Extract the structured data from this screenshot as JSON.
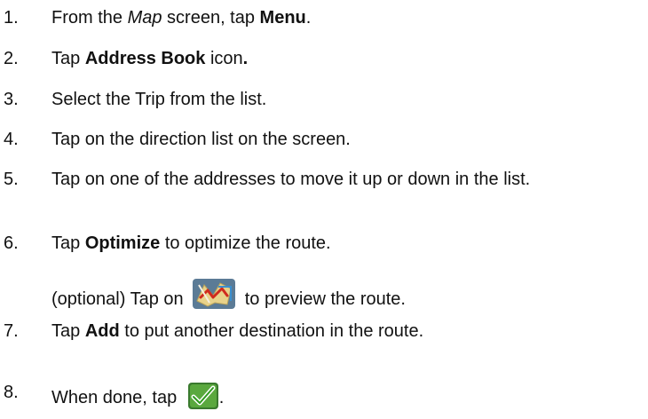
{
  "steps": [
    {
      "num": "1.",
      "a": "From the ",
      "b": "Map",
      "c": " screen, tap ",
      "d": "Menu",
      "e": "."
    },
    {
      "num": "2.",
      "a": "Tap ",
      "b": "Address Book",
      "c": " icon",
      "d": "."
    },
    {
      "num": "3.",
      "text": "Select the Trip from the list."
    },
    {
      "num": "4.",
      "text": "Tap on the direction list on the screen."
    },
    {
      "num": "5.",
      "text": "Tap on one of the addresses to move it up or down in the list."
    },
    {
      "num": "6.",
      "a": "Tap ",
      "b": "Optimize",
      "c": " to optimize the route."
    },
    {
      "num": "7.",
      "a": "Tap ",
      "b": "Add",
      "c": " to put another destination in the route."
    },
    {
      "num": "8.",
      "a": "When done, tap ",
      "c": "."
    }
  ],
  "optional": {
    "before": "(optional) Tap on ",
    "after": " to preview the route."
  },
  "icons": {
    "map": "map-route-icon",
    "done": "checkmark-done-icon"
  },
  "colors": {
    "check_green": "#2e9a1c",
    "map_bg": "#5b7b96"
  }
}
